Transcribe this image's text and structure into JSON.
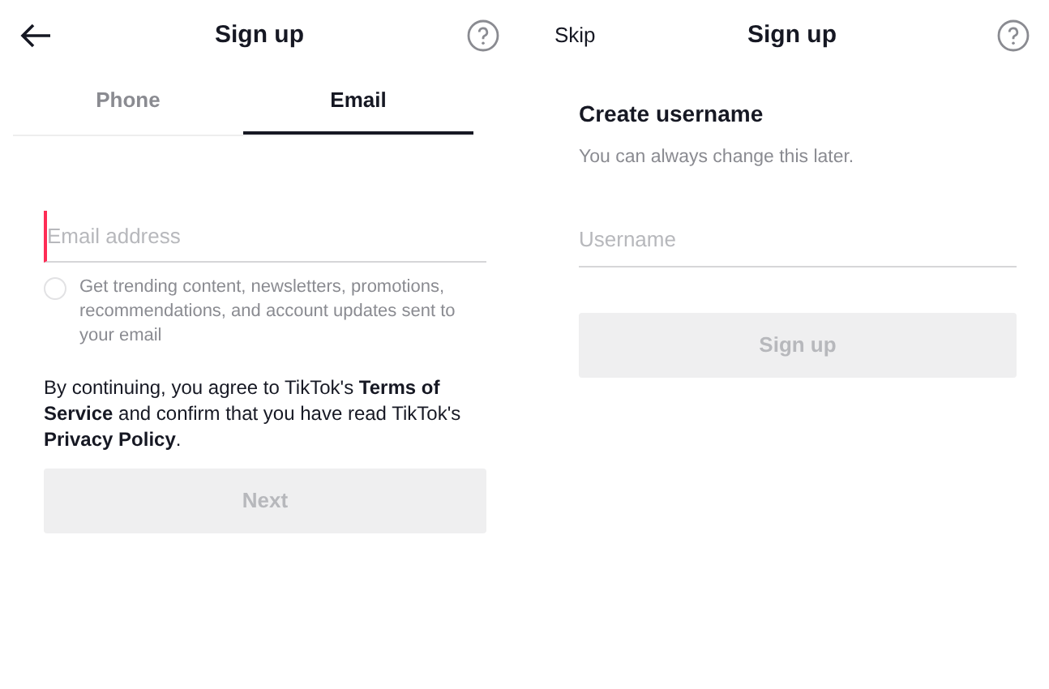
{
  "screens": [
    {
      "header": {
        "title": "Sign up"
      },
      "tabs": [
        {
          "label": "Phone",
          "selected": false
        },
        {
          "label": "Email",
          "selected": true
        }
      ],
      "field": {
        "placeholder": "Email address",
        "focused": true
      },
      "opt_in": {
        "text": "Get trending content, newsletters, promotions, recommendations, and account updates sent to your email",
        "checked": false
      },
      "consent": "By continuing, you agree to TikTok's  **Terms of Service**  and confirm that you have read TikTok's **Privacy Policy**.",
      "button": {
        "label": "Next",
        "disabled": true
      }
    },
    {
      "header": {
        "skip": "Skip",
        "title": "Sign up"
      },
      "heading": "Create username",
      "subheading": "You can always change this later.",
      "field": {
        "placeholder": "Username",
        "focused": false
      },
      "button": {
        "label": "Sign up",
        "disabled": true
      }
    }
  ]
}
